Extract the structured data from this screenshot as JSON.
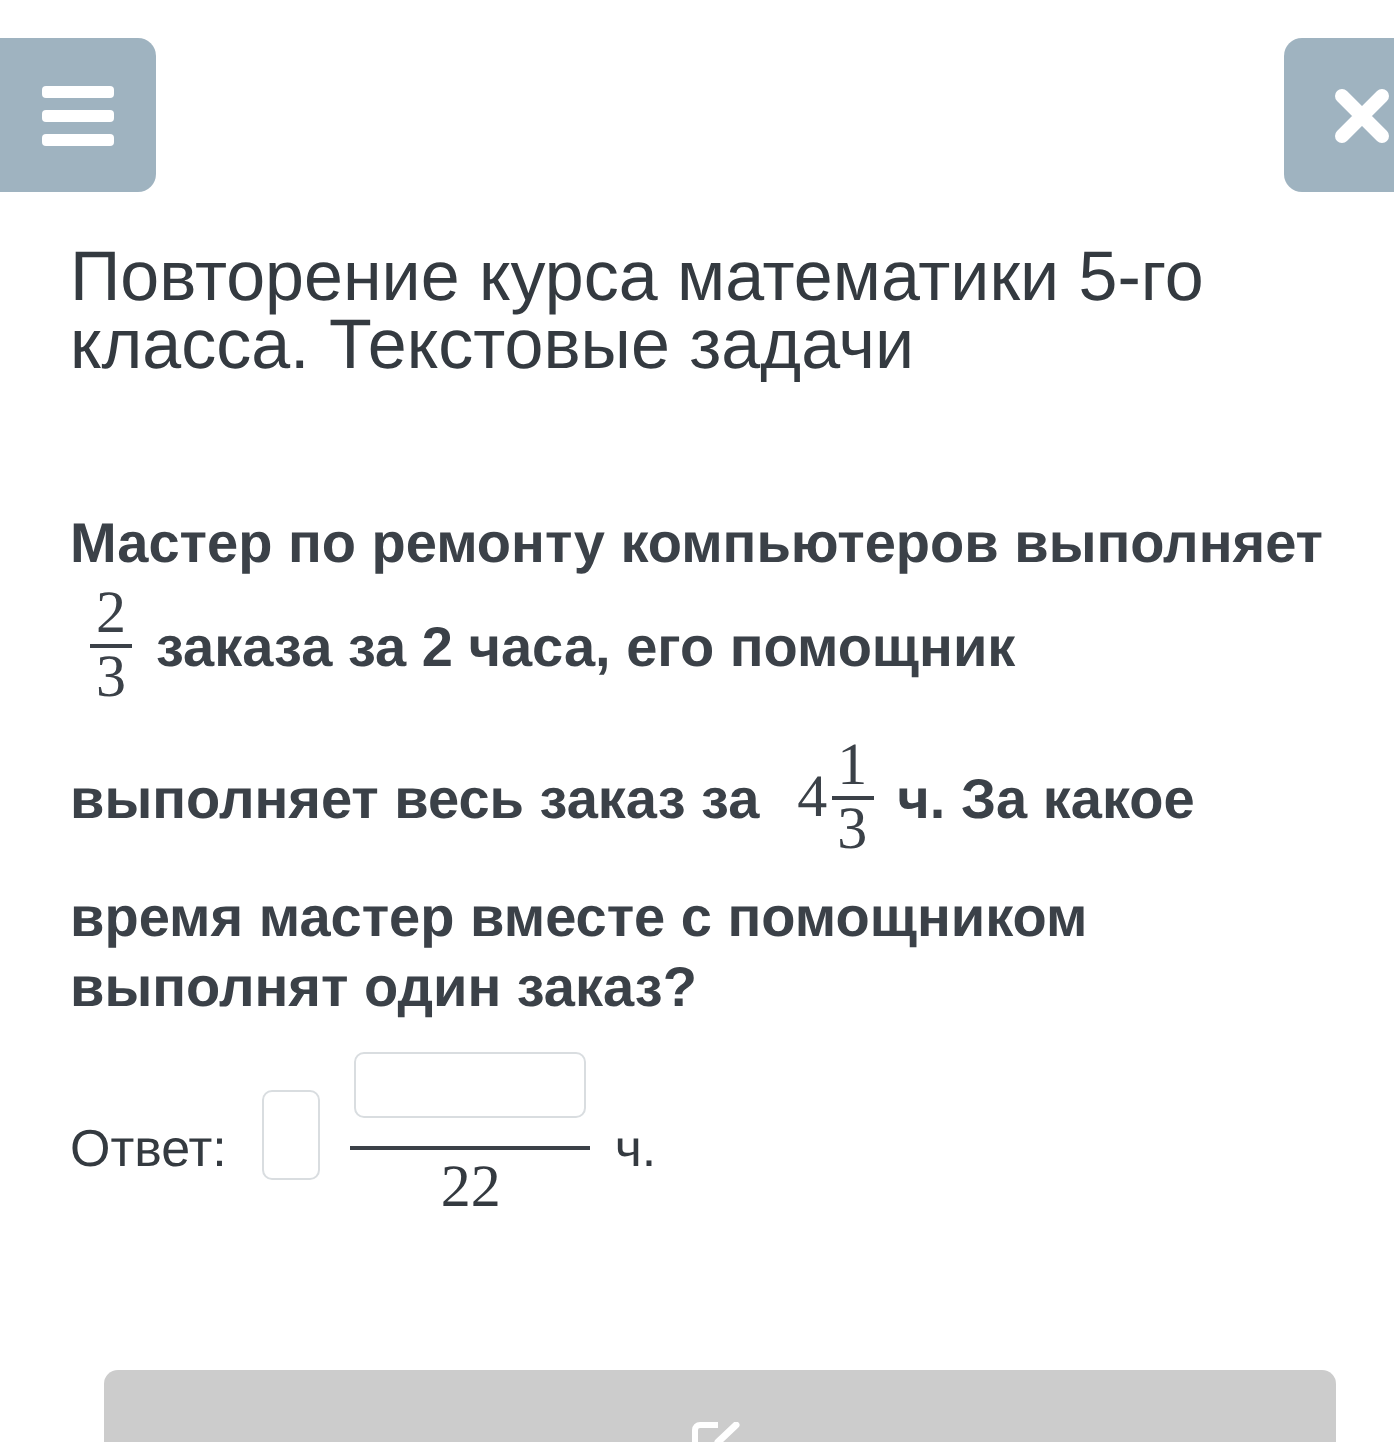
{
  "title": "Повторение курса математики 5-го класса. Текстовые задачи",
  "problem": {
    "lines": [
      [
        {
          "kind": "text",
          "text": "Мастер по ремонту компьютеров выполняет"
        }
      ],
      [
        {
          "kind": "fraction",
          "numerator": "2",
          "denominator": "3"
        },
        {
          "kind": "text",
          "text": "заказа за 2 часа, его помощник"
        }
      ],
      [
        {
          "kind": "text",
          "text": "выполняет весь заказ за"
        },
        {
          "kind": "mixed",
          "whole": "4",
          "numerator": "1",
          "denominator": "3"
        },
        {
          "kind": "text",
          "text": "ч. За какое"
        }
      ],
      [
        {
          "kind": "text",
          "text": "время мастер вместе с помощником"
        }
      ],
      [
        {
          "kind": "text",
          "text": "выполнят один заказ?"
        }
      ]
    ]
  },
  "answer": {
    "label": "Ответ:",
    "denominator": "22",
    "unit": "ч."
  },
  "submit_button": {
    "disabled": true
  }
}
